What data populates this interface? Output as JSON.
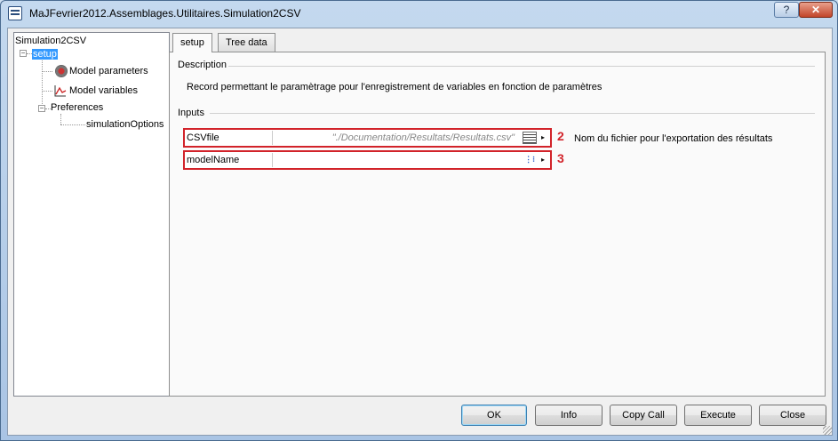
{
  "window": {
    "title": "MaJFevrier2012.Assemblages.Utilitaires.Simulation2CSV",
    "help_label": "?",
    "close_label": "✕"
  },
  "tree": {
    "root": "Simulation2CSV",
    "items": [
      {
        "label": "setup",
        "selected": true
      },
      {
        "label": "Model parameters",
        "icon": "gauge-icon"
      },
      {
        "label": "Model variables",
        "icon": "line-chart-icon"
      },
      {
        "label": "Preferences"
      },
      {
        "label": "simulationOptions"
      }
    ]
  },
  "tabs": [
    {
      "label": "setup",
      "active": true
    },
    {
      "label": "Tree data",
      "active": false
    }
  ],
  "description": {
    "section_label": "Description",
    "text": "Record permettant le paramètrage pour l'enregistrement de variables en fonction de paramètres"
  },
  "inputs": {
    "section_label": "Inputs",
    "params": [
      {
        "name": "CSVfile",
        "value": "\"./Documentation/Resultats/Resultats.csv\"",
        "marker": "2",
        "comment": "Nom du fichier pour l'exportation des résultats",
        "button_icon": "file-list-icon"
      },
      {
        "name": "modelName",
        "value": "",
        "marker": "3",
        "comment": "",
        "button_icon": "link-icon"
      }
    ]
  },
  "buttons": {
    "ok": "OK",
    "info": "Info",
    "copy_call": "Copy Call",
    "execute": "Execute",
    "close": "Close"
  },
  "colors": {
    "highlight": "#d2232a",
    "selection": "#3399ff"
  }
}
